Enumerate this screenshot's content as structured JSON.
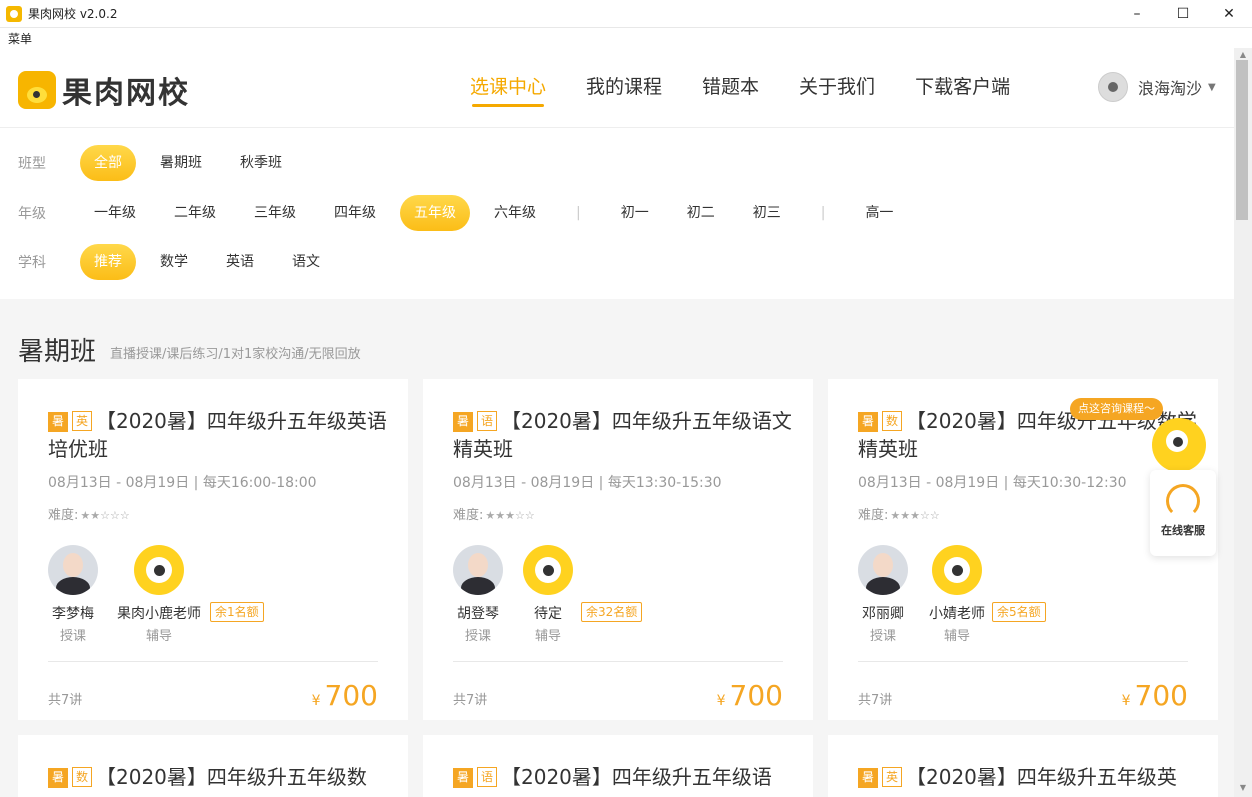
{
  "window": {
    "title": "果肉网校 v2.0.2",
    "menu": "菜单"
  },
  "header": {
    "logo_text": "果肉网校",
    "nav": [
      "选课中心",
      "我的课程",
      "错题本",
      "关于我们",
      "下载客户端"
    ],
    "user_name": "浪海淘沙"
  },
  "filters": {
    "class_type": {
      "label": "班型",
      "options": [
        "全部",
        "暑期班",
        "秋季班"
      ],
      "selected": "全部"
    },
    "grade": {
      "label": "年级",
      "options": [
        "一年级",
        "二年级",
        "三年级",
        "四年级",
        "五年级",
        "六年级",
        "初一",
        "初二",
        "初三",
        "高一"
      ],
      "selected": "五年级"
    },
    "subject": {
      "label": "学科",
      "options": [
        "推荐",
        "数学",
        "英语",
        "语文"
      ],
      "selected": "推荐"
    }
  },
  "section": {
    "title": "暑期班",
    "subtitle": "直播授课/课后练习/1对1家校沟通/无限回放"
  },
  "cards": [
    {
      "tag1": "暑",
      "tag2": "英",
      "title": "【2020暑】四年级升五年级英语培优班",
      "time": "08月13日 - 08月19日 | 每天16:00-18:00",
      "difficulty_label": "难度:",
      "difficulty": 2,
      "teacher": {
        "name": "李梦梅",
        "role": "授课"
      },
      "tutor": {
        "name": "果肉小鹿老师",
        "role": "辅导"
      },
      "remaining": "余1名额",
      "lessons": "共7讲",
      "currency": "¥",
      "price": "700"
    },
    {
      "tag1": "暑",
      "tag2": "语",
      "title": "【2020暑】四年级升五年级语文精英班",
      "time": "08月13日 - 08月19日 | 每天13:30-15:30",
      "difficulty_label": "难度:",
      "difficulty": 3,
      "teacher": {
        "name": "胡登琴",
        "role": "授课"
      },
      "tutor": {
        "name": "待定",
        "role": "辅导"
      },
      "remaining": "余32名额",
      "lessons": "共7讲",
      "currency": "¥",
      "price": "700"
    },
    {
      "tag1": "暑",
      "tag2": "数",
      "title": "【2020暑】四年级升五年级数学精英班",
      "time": "08月13日 - 08月19日 | 每天10:30-12:30",
      "difficulty_label": "难度:",
      "difficulty": 3,
      "teacher": {
        "name": "邓丽卿",
        "role": "授课"
      },
      "tutor": {
        "name": "小婧老师",
        "role": "辅导"
      },
      "remaining": "余5名额",
      "lessons": "共7讲",
      "currency": "¥",
      "price": "700"
    }
  ],
  "next_row": [
    {
      "tag1": "暑",
      "tag2": "数",
      "title": "【2020暑】四年级升五年级数"
    },
    {
      "tag1": "暑",
      "tag2": "语",
      "title": "【2020暑】四年级升五年级语"
    },
    {
      "tag1": "暑",
      "tag2": "英",
      "title": "【2020暑】四年级升五年级英"
    }
  ],
  "consult": {
    "bubble": "点这咨询课程～",
    "label": "在线客服"
  },
  "colors": {
    "accent": "#f5a623",
    "nav_active": "#f5a900"
  }
}
